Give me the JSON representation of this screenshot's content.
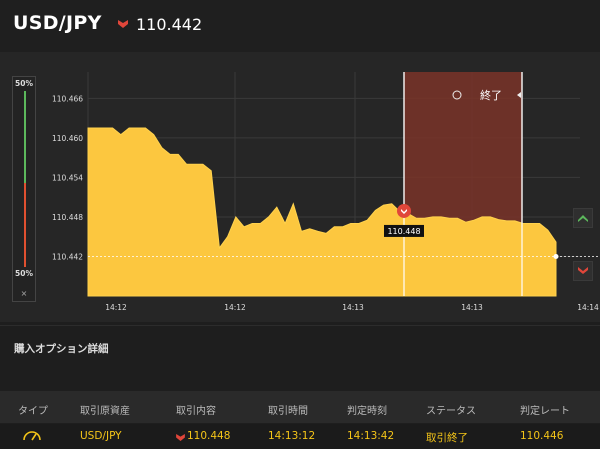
{
  "header": {
    "pair": "USD/JPY",
    "rate": "110.442",
    "direction_icon": "down-arrow-icon",
    "down_color": "#e0463a"
  },
  "gauge": {
    "top_label": "50%",
    "bottom_label": "50%",
    "close_label": "×",
    "up_share": 0.5,
    "down_share": 0.5
  },
  "chart_data": {
    "type": "area",
    "ylim": [
      110.436,
      110.47
    ],
    "yticks": [
      "110.466",
      "110.460",
      "110.454",
      "110.448",
      "110.442"
    ],
    "xticks": [
      "14:12",
      "14:12",
      "14:13",
      "14:13",
      "14:14"
    ],
    "series": [
      {
        "values": [
          110.4615,
          110.4615,
          110.4615,
          110.4615,
          110.4605,
          110.4615,
          110.4615,
          110.4615,
          110.4605,
          110.4585,
          110.4575,
          110.4575,
          110.456,
          110.456,
          110.456,
          110.455,
          110.4433,
          110.445,
          110.448,
          110.4465,
          110.447,
          110.447,
          110.448,
          110.4495,
          110.447,
          110.45,
          110.4458,
          110.4462,
          110.4458,
          110.4455,
          110.4465,
          110.4465,
          110.447,
          110.447,
          110.4475,
          110.449,
          110.4498,
          110.45,
          110.4488,
          110.4485,
          110.4478,
          110.4478,
          110.448,
          110.448,
          110.4478,
          110.4478,
          110.4472,
          110.4475,
          110.448,
          110.448,
          110.4476,
          110.4474,
          110.4474,
          110.447,
          110.447,
          110.447,
          110.446,
          110.4442
        ]
      }
    ],
    "fill_color": "#fcc73f",
    "current_rate_line": "110.442",
    "entry_marker_label": "110.448",
    "expiry_zone_label": "終了",
    "expiry_zone_color": "#7a3429",
    "grid": true
  },
  "purchase": {
    "title": "購入オプション詳細",
    "columns": [
      "タイプ",
      "取引原資産",
      "取引内容",
      "取引時間",
      "判定時刻",
      "ステータス",
      "判定レート"
    ],
    "row": {
      "type_icon": "gauge-icon",
      "asset": "USD/JPY",
      "content": "110.448",
      "trade_time": "14:13:12",
      "judge_time": "14:13:42",
      "status": "取引終了",
      "judge_rate": "110.446"
    }
  }
}
